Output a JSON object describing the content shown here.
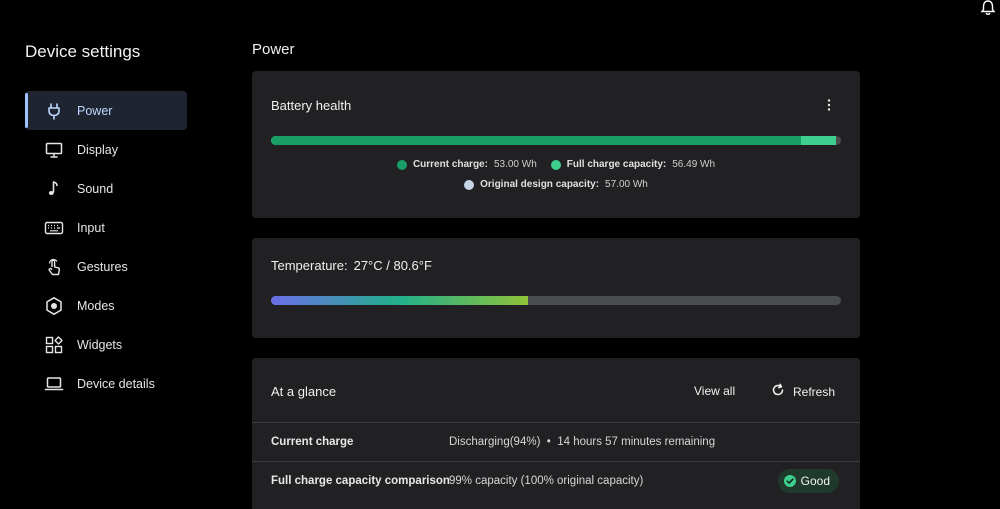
{
  "sidebar": {
    "title": "Device settings",
    "items": [
      {
        "label": "Power",
        "icon": "plug-icon",
        "active": true
      },
      {
        "label": "Display",
        "icon": "monitor-icon"
      },
      {
        "label": "Sound",
        "icon": "music-note-icon"
      },
      {
        "label": "Input",
        "icon": "keyboard-icon"
      },
      {
        "label": "Gestures",
        "icon": "touch-gesture-icon"
      },
      {
        "label": "Modes",
        "icon": "hexagon-mode-icon"
      },
      {
        "label": "Widgets",
        "icon": "widgets-icon"
      },
      {
        "label": "Device details",
        "icon": "laptop-icon"
      }
    ]
  },
  "page": {
    "title": "Power"
  },
  "battery": {
    "title": "Battery health",
    "current_fraction": 0.93,
    "full_fraction": 0.991,
    "legend": {
      "current_label": "Current charge:",
      "current_value": "53.00 Wh",
      "full_label": "Full charge capacity:",
      "full_value": "56.49 Wh",
      "design_label": "Original design capacity:",
      "design_value": "57.00 Wh"
    },
    "colors": {
      "current": "#1a9e67",
      "full": "#3ecf8e",
      "design": "#c8d4e8",
      "track": "#4a4c50"
    }
  },
  "temperature": {
    "label": "Temperature:",
    "value": "27°C / 80.6°F",
    "fraction": 0.45,
    "gradient": [
      "#6b6ee8",
      "#22b08a",
      "#8fc23a"
    ]
  },
  "glance": {
    "title": "At a glance",
    "view_all": "View all",
    "refresh": "Refresh",
    "rows": [
      {
        "key": "Current charge",
        "value": "Discharging(94%)  •  14 hours 57 minutes remaining"
      },
      {
        "key": "Full charge capacity comparison",
        "value": "99% capacity (100% original capacity)",
        "badge": "Good"
      }
    ]
  }
}
